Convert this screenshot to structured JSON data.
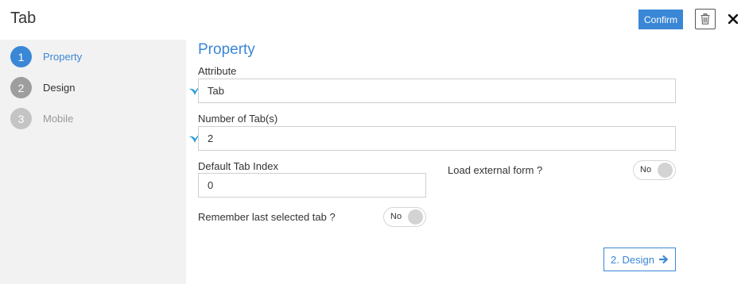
{
  "header": {
    "title": "Tab",
    "confirm_label": "Confirm",
    "trash_icon": "trash-icon",
    "close_icon": "close-icon"
  },
  "sidebar": {
    "steps": [
      {
        "number": "1",
        "label": "Property",
        "state": "active",
        "color": "#3a87d6"
      },
      {
        "number": "2",
        "label": "Design",
        "state": "pending",
        "color": "#9e9e9e"
      },
      {
        "number": "3",
        "label": "Mobile",
        "state": "disabled",
        "color": "#c4c4c4"
      }
    ]
  },
  "main": {
    "section_title": "Property",
    "attribute": {
      "label": "Attribute",
      "value": "Tab"
    },
    "number_of_tabs": {
      "label": "Number of Tab(s)",
      "value": "2"
    },
    "default_tab_index": {
      "label": "Default Tab Index",
      "value": "0"
    },
    "load_external_form": {
      "label": "Load external form ?",
      "value": "No"
    },
    "remember_last_tab": {
      "label": "Remember last selected tab ?",
      "value": "No"
    },
    "next_button": {
      "label": "2. Design",
      "icon": "arrow-right-icon"
    }
  },
  "colors": {
    "accent": "#3a87d6",
    "sidebar_bg": "#f2f2f2",
    "check": "#2e9bd6"
  }
}
